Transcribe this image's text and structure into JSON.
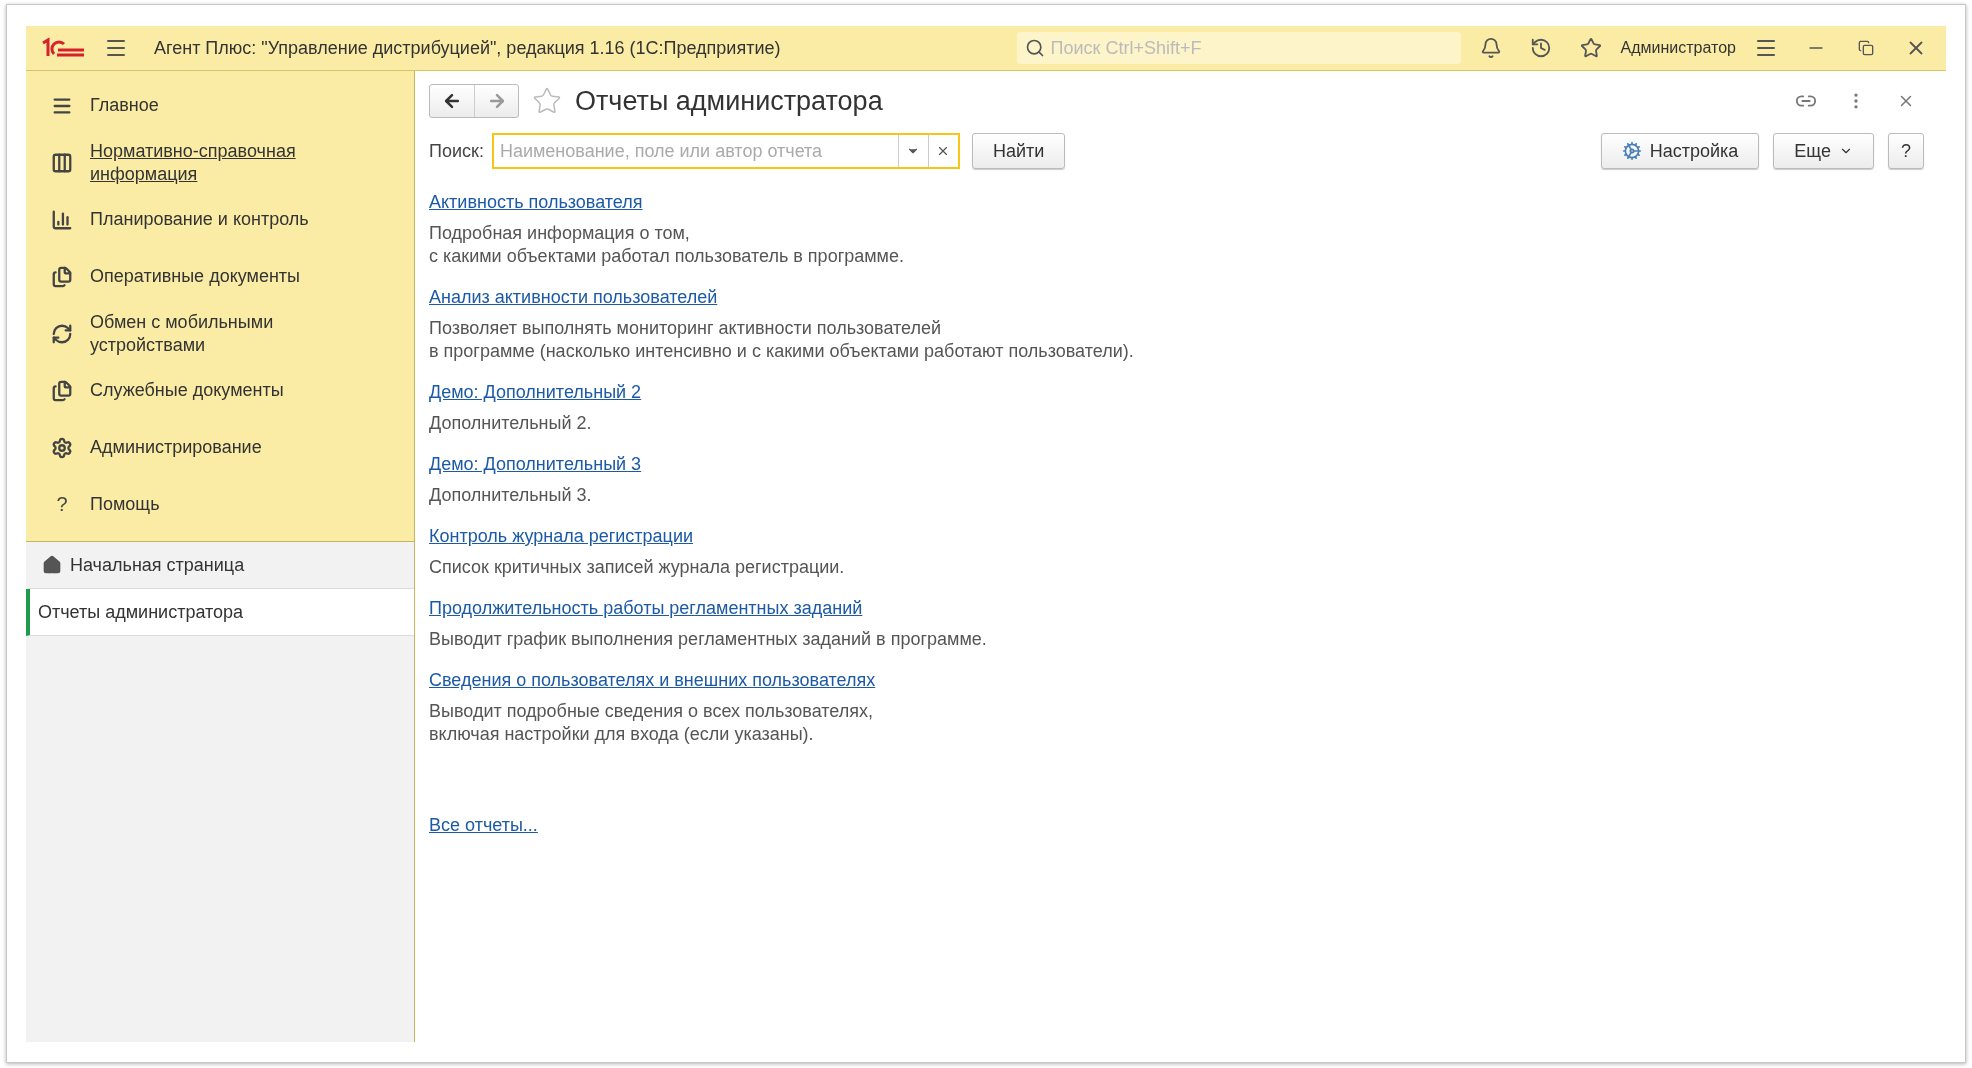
{
  "window": {
    "title": "Агент Плюс: \"Управление дистрибуцией\", редакция 1.16  (1С:Предприятие)",
    "search_placeholder": "Поиск Ctrl+Shift+F",
    "user": "Администратор"
  },
  "sidebar": {
    "sections": [
      {
        "label": "Главное",
        "hovered": false
      },
      {
        "label": "Нормативно-справочная информация",
        "hovered": true
      },
      {
        "label": "Планирование и контроль",
        "hovered": false
      },
      {
        "label": "Оперативные документы",
        "hovered": false
      },
      {
        "label": "Обмен с мобильными устройствами",
        "hovered": false
      },
      {
        "label": "Служебные документы",
        "hovered": false
      },
      {
        "label": "Администрирование",
        "hovered": false
      },
      {
        "label": "Помощь",
        "hovered": false,
        "glyph": "?"
      }
    ],
    "open_pages": [
      {
        "kind": "home",
        "label": "Начальная страница",
        "selected": false
      },
      {
        "kind": "page",
        "label": "Отчеты администратора",
        "selected": true
      }
    ]
  },
  "form": {
    "title": "Отчеты администратора",
    "search_label": "Поиск:",
    "search_placeholder": "Наименование, поле или автор отчета",
    "find_button": "Найти",
    "settings_button": "Настройка",
    "more_button": "Еще",
    "help_button": "?",
    "reports": [
      {
        "title": "Активность пользователя",
        "description": "Подробная информация о том,\nс какими объектами работал пользователь в программе."
      },
      {
        "title": "Анализ активности пользователей",
        "description": "Позволяет выполнять мониторинг активности пользователей\nв программе (насколько интенсивно и с какими объектами работают пользователи)."
      },
      {
        "title": "Демо: Дополнительный 2",
        "description": "Дополнительный 2."
      },
      {
        "title": "Демо: Дополнительный 3",
        "description": "Дополнительный 3."
      },
      {
        "title": "Контроль журнала регистрации",
        "description": "Список критичных записей журнала регистрации."
      },
      {
        "title": "Продолжительность работы регламентных заданий",
        "description": "Выводит график выполнения регламентных заданий в программе."
      },
      {
        "title": "Сведения о пользователях и внешних пользователях",
        "description": "Выводит подробные сведения о всех пользователях,\nвключая настройки для входа (если указаны)."
      }
    ],
    "all_reports_link": "Все отчеты..."
  }
}
